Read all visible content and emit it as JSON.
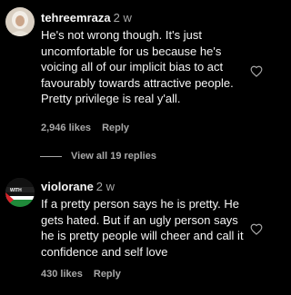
{
  "comments": [
    {
      "username": "tehreemraza",
      "time": "2 w",
      "text": "He's not wrong though. It's just uncomfortable for us because he's voicing all of our implicit bias to act favourably towards attractive people. Pretty privilege is real y'all.",
      "likes": "2,946 likes",
      "reply": "Reply"
    },
    {
      "username": "violorane",
      "time": "2 w",
      "text": "If a pretty person says he is pretty. He gets hated. But if an ugly person says he is pretty people will cheer and call it confidence and self love",
      "likes": "430 likes",
      "reply": "Reply",
      "avatar_text": "WITH"
    }
  ],
  "view_replies": "View all 19 replies",
  "colors": {
    "background": "#000000",
    "text": "#f5f5f5",
    "muted": "#a8a8a8"
  }
}
